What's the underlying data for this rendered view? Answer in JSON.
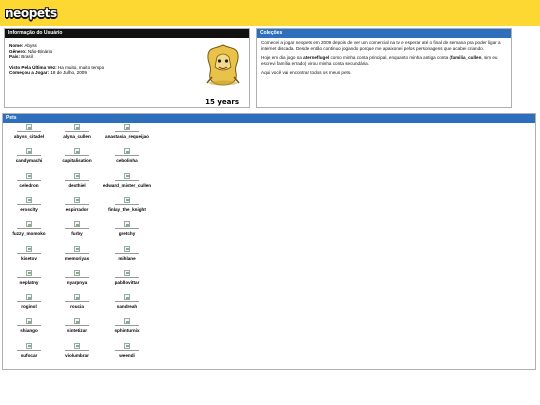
{
  "header": {
    "logo_text": "neopets"
  },
  "info": {
    "title": "Informação do Usuário",
    "fields": [
      {
        "label": "Nome:",
        "value": "Abyss"
      },
      {
        "label": "Gênero:",
        "value": "Não-Binário"
      },
      {
        "label": "País:",
        "value": "Brasil"
      }
    ],
    "fields2": [
      {
        "label": "Visto Pela Última Vez:",
        "value": "Ha muito, muito tempo"
      },
      {
        "label": "Começou a Jogar:",
        "value": "18 de Julho, 2009"
      }
    ],
    "badge_text": "15 years"
  },
  "collections": {
    "title": "Coleções",
    "p1": "Comecei a jogar neopets em 2009 depois de ver um comercial na tv e esperar até o final de semana pra poder ligar a internet discada. Desde então continuo jogando porque me apaixonei pelos personagens que acabei criando.",
    "p2a": "Hoje em dia jogo na ",
    "p2b": "aterneflugel",
    "p2c": " como minha conta principal, enquanto minha antiga conta (",
    "p2d": "familia_cullen",
    "p2e": ", sim eu escrevi família errado) virou minha conta secundária.",
    "p3": "Aqui você vai encontrar todos os meus pets."
  },
  "pets": {
    "title": "Pets",
    "rows": [
      [
        "abyss_citadel",
        "alyna_cullen",
        "anastasia_requeijao"
      ],
      [
        "candymachi",
        "capitalisation",
        "cebolinha"
      ],
      [
        "celedron",
        "dexthiel",
        "edward_mister_cullen"
      ],
      [
        "erosclty",
        "espirrador",
        "finlay_the_knight"
      ],
      [
        "fuzzy_momoko",
        "furby",
        "gretchy"
      ],
      [
        "kisetov",
        "memoriyas",
        "mihlane"
      ],
      [
        "neplatny",
        "nyarpnya",
        "pabllovittar"
      ],
      [
        "roginol",
        "roucia",
        "sandreah"
      ],
      [
        "shiango",
        "sintetizar",
        "sphinturnix"
      ],
      [
        "sufocar",
        "violumbrar",
        "weendi"
      ]
    ]
  }
}
